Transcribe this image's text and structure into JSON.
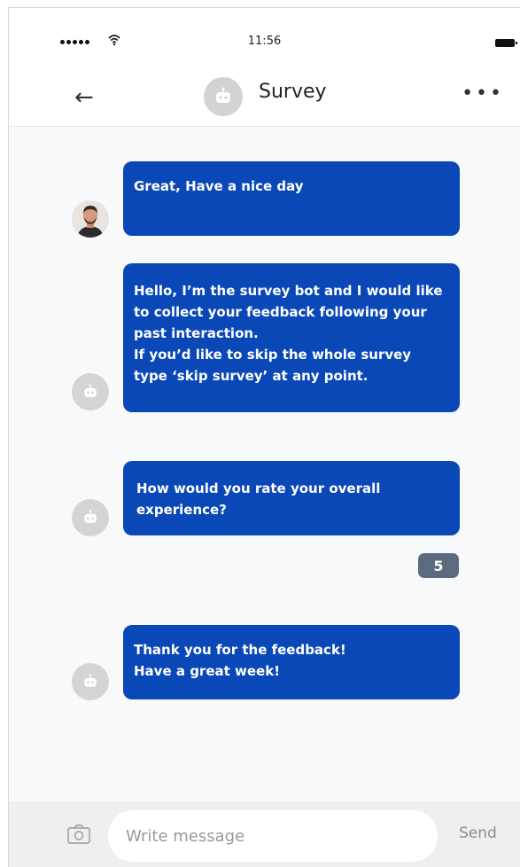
{
  "status_bar": {
    "time": "11:56"
  },
  "header": {
    "title": "Survey"
  },
  "messages": [
    {
      "sender": "user",
      "text": "Great, Have a nice day"
    },
    {
      "sender": "bot",
      "text": "Hello, I’m the survey bot and I would like to collect your feedback following your past interaction.\nIf you’d like to skip the whole survey type ‘skip survey’ at any point."
    },
    {
      "sender": "bot",
      "text": "How would you rate your overall experience?"
    },
    {
      "sender": "bot",
      "text": "Thank you for the feedback!\nHave a great week!"
    }
  ],
  "rating_reply": "5",
  "composer": {
    "placeholder": "Write message",
    "send_label": "Send"
  },
  "colors": {
    "bubble": "#0a48b8",
    "rating_badge": "#5b6b7d",
    "chat_bg": "#f8f9fb"
  }
}
